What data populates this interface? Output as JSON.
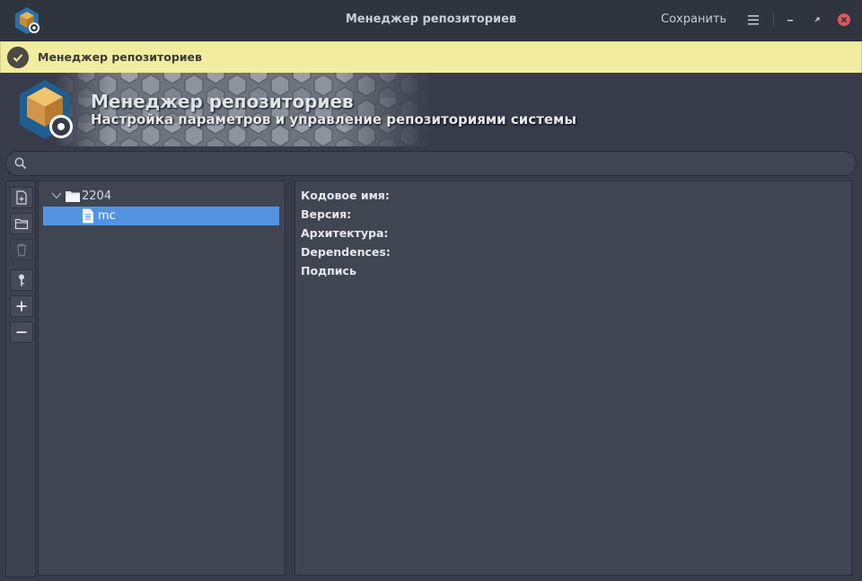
{
  "window": {
    "title": "Менеджер репозиториев",
    "save_label": "Сохранить",
    "controls": [
      "menu-icon",
      "minimize-icon",
      "maximize-icon",
      "close-icon"
    ]
  },
  "infobar": {
    "message": "Менеджер репозиториев",
    "icon": "check-icon"
  },
  "banner": {
    "title": "Менеджер репозиториев",
    "subtitle": "Настройка параметров и управление репозиториями системы"
  },
  "search": {
    "placeholder": "",
    "value": ""
  },
  "toolbar": {
    "buttons": [
      "new-file-icon",
      "folder-icon",
      "trash-icon",
      "key-icon",
      "plus-icon",
      "minus-icon"
    ]
  },
  "tree": {
    "folder": {
      "label": "2204",
      "expanded": true
    },
    "items": [
      {
        "label": "mc",
        "selected": true
      }
    ]
  },
  "details": {
    "fields": [
      {
        "label": "Кодовое имя:"
      },
      {
        "label": "Версия:"
      },
      {
        "label": "Архитектура:"
      },
      {
        "label": "Dependences:"
      },
      {
        "label": "Подпись"
      }
    ]
  },
  "colors": {
    "selection": "#5294e2",
    "infobar": "#f2eca0",
    "close": "#e0565b",
    "background": "#383c4a"
  }
}
